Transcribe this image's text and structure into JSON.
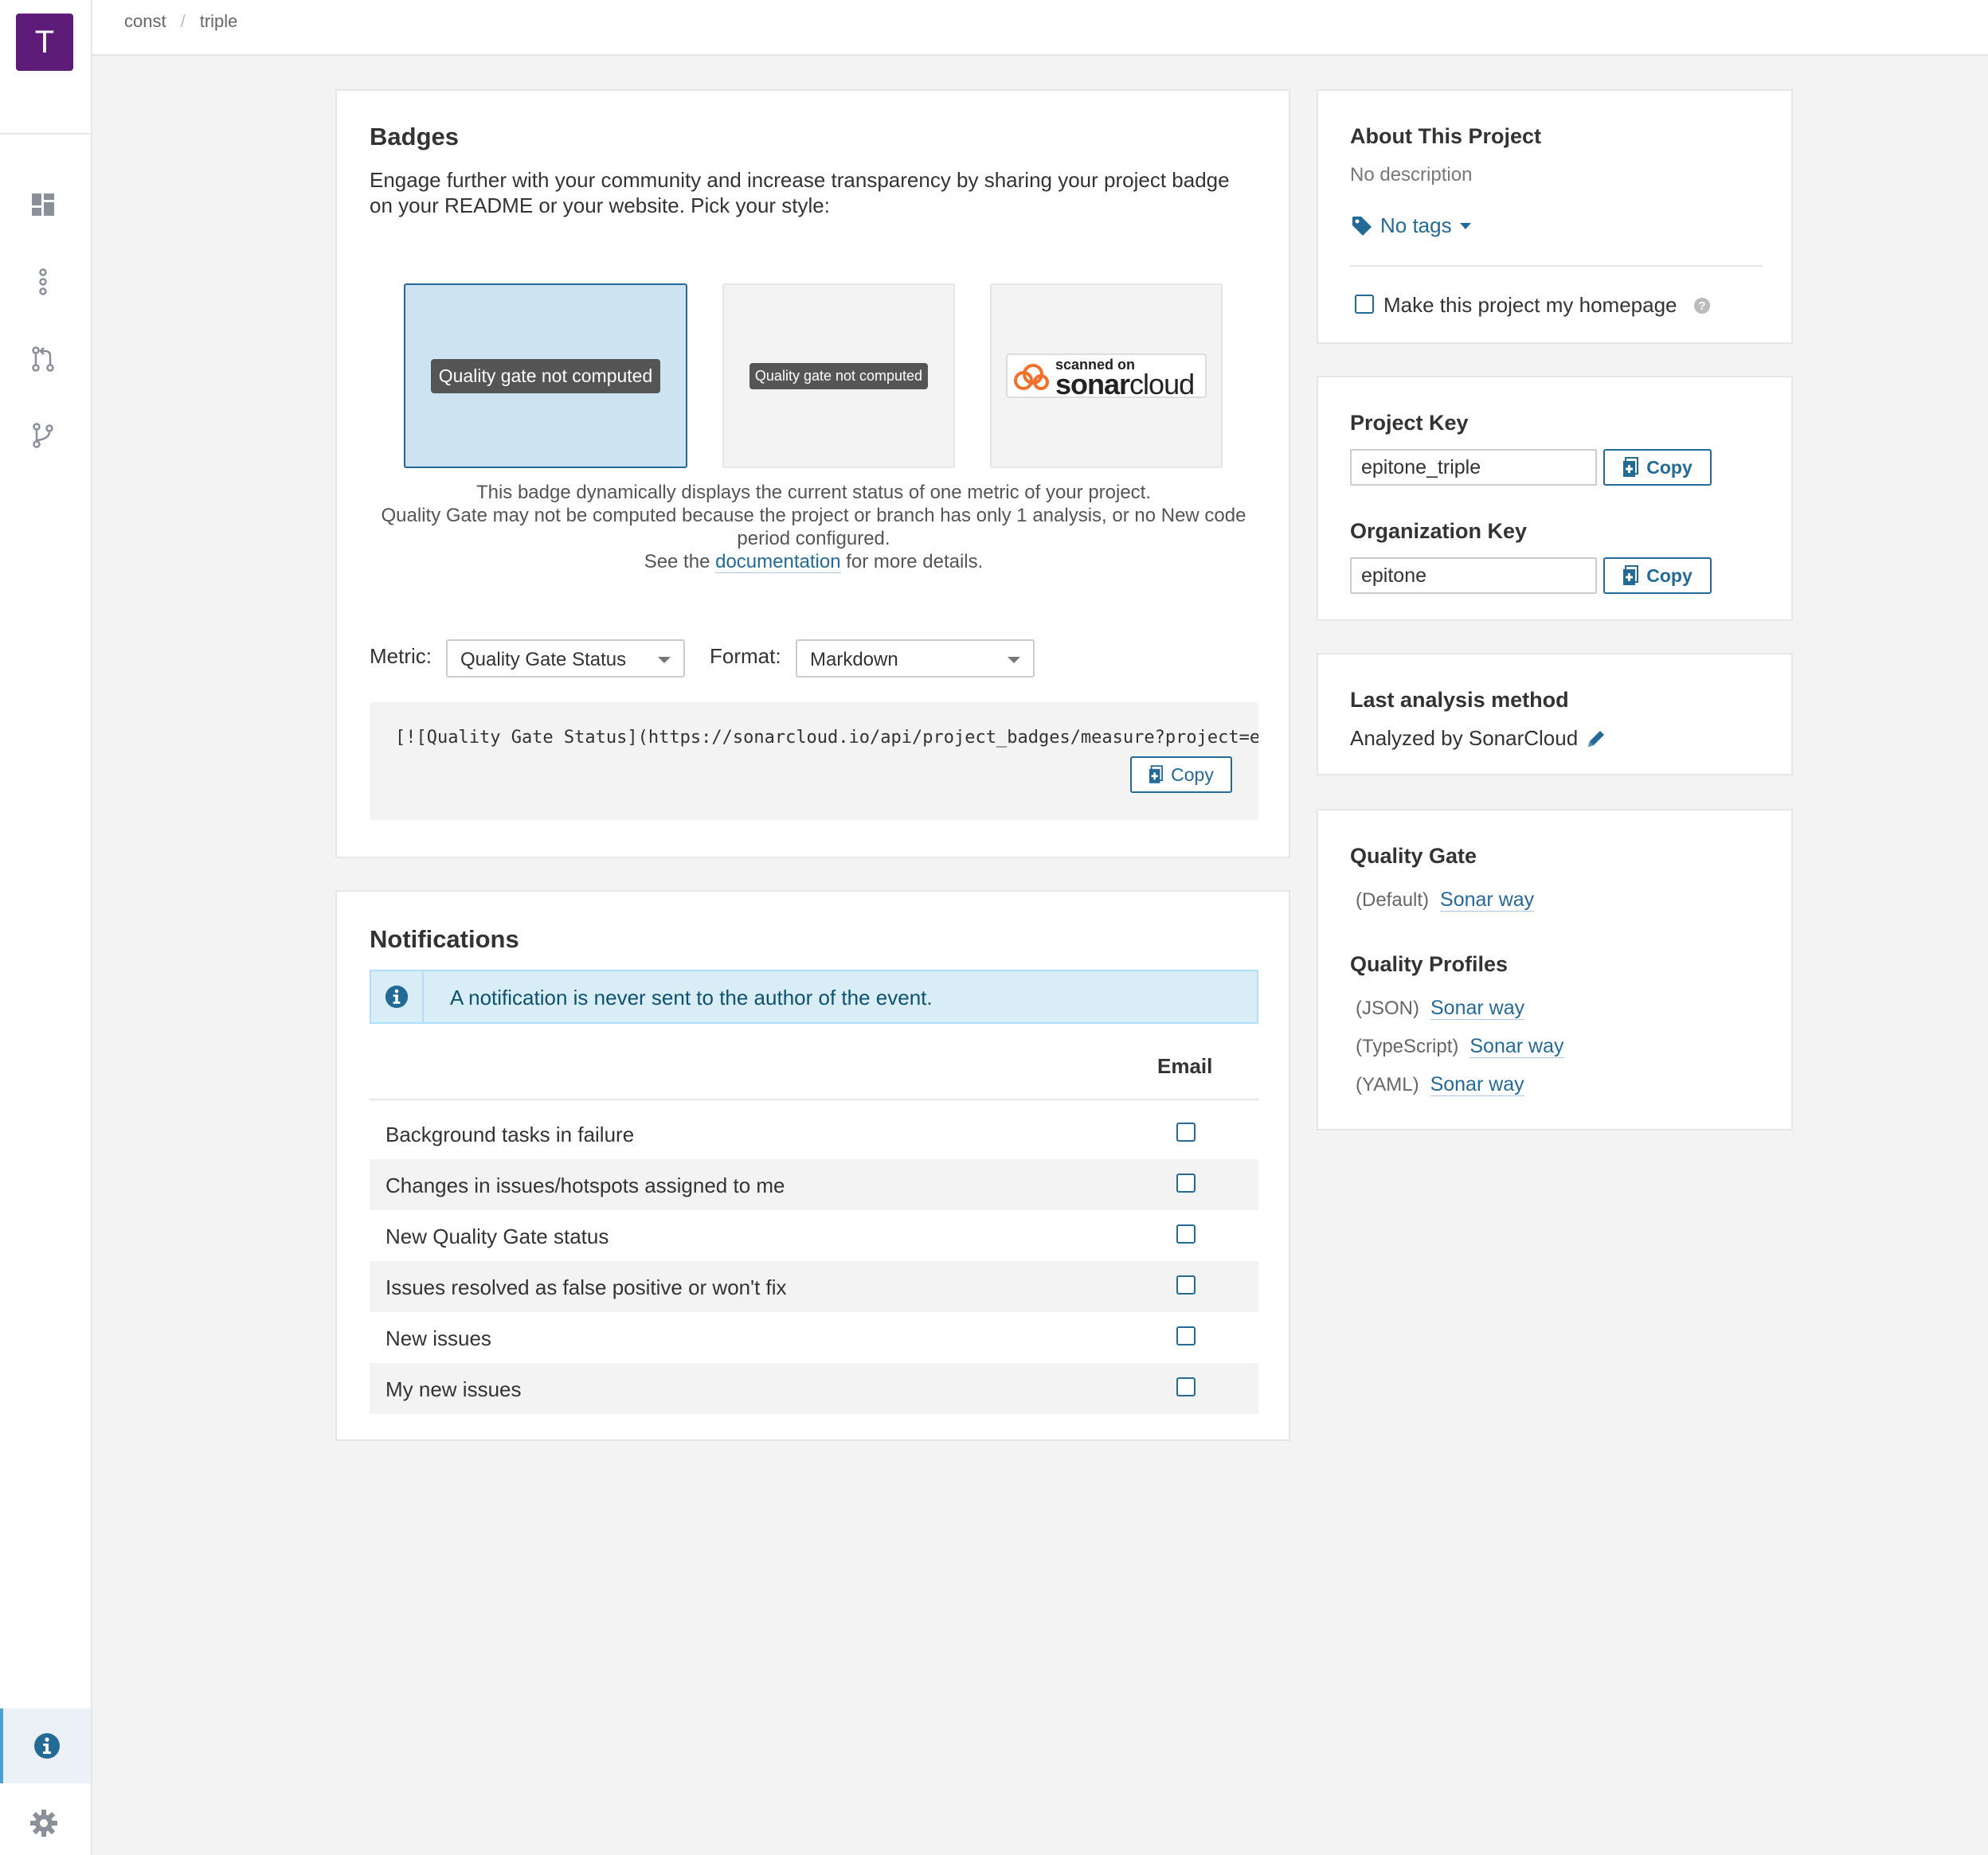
{
  "sidebar": {
    "avatar_letter": "T",
    "items": [
      {
        "name": "overview-icon"
      },
      {
        "name": "issues-icon"
      },
      {
        "name": "pull-requests-icon"
      },
      {
        "name": "branches-icon"
      },
      {
        "name": "info-icon"
      },
      {
        "name": "gear-icon"
      }
    ]
  },
  "breadcrumb": {
    "org": "const",
    "project": "triple"
  },
  "badges": {
    "title": "Badges",
    "intro": "Engage further with your community and increase transparency by sharing your project badge on your README or your website. Pick your style:",
    "options": [
      {
        "label": "Quality gate not computed",
        "selected": true
      },
      {
        "label": "Quality gate not computed",
        "selected": false
      },
      {
        "top": "scanned on",
        "brand_a": "sonar",
        "brand_b": "cloud",
        "selected": false
      }
    ],
    "desc_line1": "This badge dynamically displays the current status of one metric of your project.",
    "desc_line2": "Quality Gate may not be computed because the project or branch has only 1 analysis, or no New code period configured.",
    "desc_see": "See the",
    "desc_link": "documentation",
    "desc_after": "for more details.",
    "metric_label": "Metric:",
    "metric_value": "Quality Gate Status",
    "format_label": "Format:",
    "format_value": "Markdown",
    "code": "[![Quality Gate Status](https://sonarcloud.io/api/project_badges/measure?project=epitone_triple&metric=alert_status)](https://sonarcloud.io/summary/new_code?id=epitone_triple)",
    "copy_label": "Copy"
  },
  "notifications": {
    "title": "Notifications",
    "alert": "A notification is never sent to the author of the event.",
    "email_header": "Email",
    "rows": [
      {
        "label": "Background tasks in failure",
        "checked": false
      },
      {
        "label": "Changes in issues/hotspots assigned to me",
        "checked": false
      },
      {
        "label": "New Quality Gate status",
        "checked": false
      },
      {
        "label": "Issues resolved as false positive or won't fix",
        "checked": false
      },
      {
        "label": "New issues",
        "checked": false
      },
      {
        "label": "My new issues",
        "checked": false
      }
    ]
  },
  "about": {
    "title": "About This Project",
    "description": "No description",
    "tags": "No tags",
    "homepage_label": "Make this project my homepage"
  },
  "keys": {
    "project_key_title": "Project Key",
    "project_key": "epitone_triple",
    "org_key_title": "Organization Key",
    "org_key": "epitone",
    "copy_label": "Copy"
  },
  "last_analysis": {
    "title": "Last analysis method",
    "value": "Analyzed by SonarCloud"
  },
  "quality": {
    "gate_title": "Quality Gate",
    "gate_prefix": "(Default)",
    "gate_name": "Sonar way",
    "profiles_title": "Quality Profiles",
    "profiles": [
      {
        "lang": "(JSON)",
        "name": "Sonar way"
      },
      {
        "lang": "(TypeScript)",
        "name": "Sonar way"
      },
      {
        "lang": "(YAML)",
        "name": "Sonar way"
      }
    ]
  },
  "colors": {
    "accent": "#236a97",
    "avatar": "#5d1c78",
    "selected_bg": "#cde3f1",
    "alert_bg": "#d9edf7"
  }
}
